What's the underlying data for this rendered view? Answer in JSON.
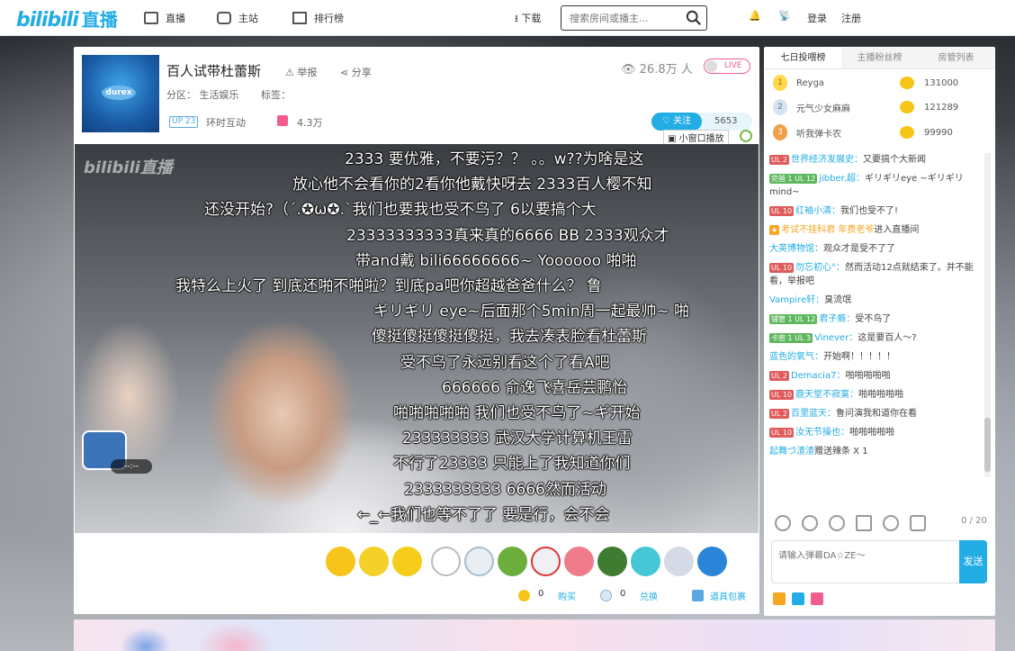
{
  "nav": {
    "logo_bili": "bilibili",
    "logo_suffix": "直播",
    "items": [
      {
        "label": "直播"
      },
      {
        "label": "主站"
      },
      {
        "label": "排行榜"
      }
    ],
    "download": "下载",
    "search_placeholder": "搜索房间或播主...",
    "login": "登录",
    "register": "注册"
  },
  "room": {
    "cover_brand": "durex",
    "title": "百人试带杜蕾斯",
    "report": "举报",
    "share": "分享",
    "category": "分区： 生活娱乐",
    "tags": "标签：",
    "ul_badge": "UP 23",
    "interaction": "环时互动",
    "gifts": "4.3万",
    "viewers": "26.8万 人",
    "live": "LIVE",
    "follow": "关注",
    "follow_count": "5653",
    "mini_play": "小窗口播放"
  },
  "video": {
    "watermark": "bilibili直播",
    "chest_timer": "--:--",
    "danmaku": [
      "2333 要优雅，不要污？？  。。w??为啥是这",
      "放心他不会看你的2看你他戴快呀去 2333百人樱不知",
      "还没开始?（´.✪ω✪.`我们也要我也受不鸟了   6以要搞个大",
      "23333333333真来真的6666 BB  2333观众才",
      "带and戴 bili66666666~ Yoooooo      啪啪",
      "我特么上火了   到底还啪不啪啦？到底pa吧你超越爸爸什么？ 鲁",
      "ギリギリ eye~后面那个5min周一起最帅~ 啪",
      "傻挺傻挺傻挺傻挺，我去凑表脸看杜蕾斯",
      "受不鸟了永远别看这个了看A吧",
      "666666  俞逸飞喜岳芸鹏怡",
      "啪啪啪啪啪          我们也受不鸟了~ギ开始",
      "233333333          武汉大学计算机王雷",
      "不行了23333          只能上了我知道你们",
      "2333333333          6666然而活动",
      "←_←我们也等不了了          要是行，会不会"
    ]
  },
  "currency": {
    "gold": "0",
    "buy": "购买",
    "silver": "0",
    "exchange": "兑换",
    "bag": "道具包裹"
  },
  "side": {
    "tabs": [
      "七日投喂榜",
      "主播粉丝榜",
      "房管列表"
    ],
    "ranks": [
      {
        "pos": "1",
        "name": "Reyga",
        "score": "131000"
      },
      {
        "pos": "2",
        "name": "元气少女麻麻",
        "score": "121289"
      },
      {
        "pos": "3",
        "name": "听我弹卡农",
        "score": "99990"
      }
    ],
    "messages": [
      {
        "badge": "UL 2",
        "user": "世界经济发展史：",
        "text": "又要搞个大新闻"
      },
      {
        "badge": "完爸 1  UL 12",
        "user": "jibber.超：",
        "text": "ギリギリeye ~ギリギリmind~"
      },
      {
        "badge": "UL 10",
        "user": "红袖小清：",
        "text": "我们也受不了!"
      },
      {
        "badge": "★",
        "user": "考试不挂科君 年费老爷",
        "text": "进入直播间"
      },
      {
        "badge": "",
        "user": "大英博物馆：",
        "text": "观众才是受不了了"
      },
      {
        "badge": "UL 10",
        "user": "勿忘初心°：",
        "text": "然而活动12点就结束了。并不能看，举报吧"
      },
      {
        "badge": "",
        "user": "Vampire轩：",
        "text": "臭流氓"
      },
      {
        "badge": "铺管 1  UL 12",
        "user": "君子瘾：",
        "text": "受不鸟了"
      },
      {
        "badge": "卡密 1  UL 3",
        "user": "Vinever：",
        "text": "这是要百人～?"
      },
      {
        "badge": "",
        "user": "蓝色的氧气：",
        "text": "开始啊！！！！！"
      },
      {
        "badge": "UL 2",
        "user": "Demacia7：",
        "text": "啪啪啪啪啪"
      },
      {
        "badge": "UL 10",
        "user": "鹿天堂不寂寞：",
        "text": "啪啪啪啪啪"
      },
      {
        "badge": "UL 2",
        "user": "百里蓝天：",
        "text": "鲁问演我和道你在看"
      },
      {
        "badge": "UL 10",
        "user": "汝无节操也：",
        "text": "啪啪啪啪啪"
      },
      {
        "badge": "",
        "user": "起舞づ渣渣",
        "text": "赠送辣条 X 1"
      }
    ],
    "counter": "0 / 20",
    "input_placeholder": "请输入弹幕DA☆ZE～",
    "send": "发送"
  }
}
